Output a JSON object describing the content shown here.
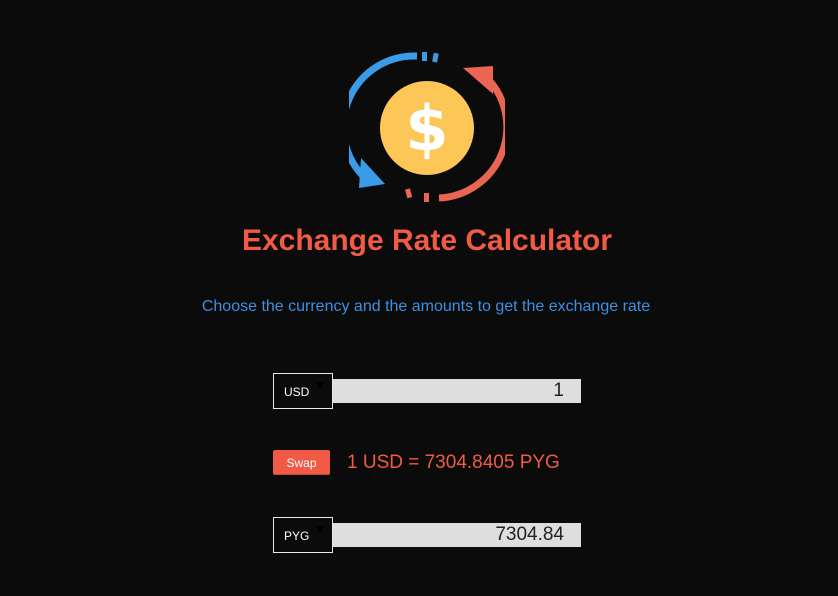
{
  "colors": {
    "background": "#0b0b0b",
    "accent": "#f15a45",
    "subtitle": "#3d8fe0",
    "coin": "#fcc757",
    "arrow_blue": "#3b9be6",
    "arrow_red": "#ea6552",
    "input_bg": "#dedede"
  },
  "logo": {
    "icon": "currency-exchange-icon",
    "symbol": "$"
  },
  "header": {
    "title": "Exchange Rate Calculator",
    "subtitle": "Choose the currency and the amounts to get the exchange rate"
  },
  "converter": {
    "from": {
      "currency": "USD",
      "amount": "1"
    },
    "swap_label": "Swap",
    "rate_text": "1 USD = 7304.8405 PYG",
    "to": {
      "currency": "PYG",
      "amount": "7304.84"
    }
  }
}
